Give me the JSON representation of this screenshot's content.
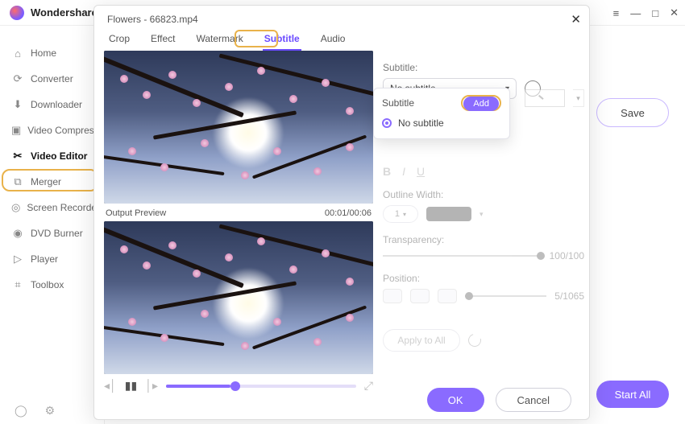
{
  "app": {
    "brand": "Wondershare"
  },
  "window_controls": {
    "hamburger": "≡",
    "min": "—",
    "max": "□",
    "close": "✕"
  },
  "sidebar": {
    "items": [
      {
        "label": "Home",
        "icon": "⌂"
      },
      {
        "label": "Converter",
        "icon": "⟳"
      },
      {
        "label": "Downloader",
        "icon": "⬇"
      },
      {
        "label": "Video Compressor",
        "icon": "▣"
      },
      {
        "label": "Video Editor",
        "icon": "✂"
      },
      {
        "label": "Merger",
        "icon": "⧉"
      },
      {
        "label": "Screen Recorder",
        "icon": "◎"
      },
      {
        "label": "DVD Burner",
        "icon": "◉"
      },
      {
        "label": "Player",
        "icon": "▷"
      },
      {
        "label": "Toolbox",
        "icon": "⌗"
      }
    ],
    "active_index": 4,
    "bottom": {
      "user": "◯",
      "settings": "⚙"
    }
  },
  "background_panel": {
    "save_label": "Save",
    "start_all_label": "Start All"
  },
  "modal": {
    "title": "Flowers - 66823.mp4",
    "tabs": [
      "Crop",
      "Effect",
      "Watermark",
      "Subtitle",
      "Audio"
    ],
    "active_tab_index": 3,
    "preview": {
      "output_label": "Output Preview",
      "timecode": "00:01/00:06"
    },
    "settings": {
      "subtitle_label": "Subtitle:",
      "subtitle_value": "No subtitle",
      "popover": {
        "heading": "Subtitle",
        "add_label": "Add",
        "option": "No subtitle"
      },
      "outline_label": "Outline Width:",
      "outline_value": "1",
      "transparency_label": "Transparency:",
      "transparency_value": "100/100",
      "position_label": "Position:",
      "position_value": "5/1065",
      "apply_label": "Apply to All"
    },
    "footer": {
      "ok": "OK",
      "cancel": "Cancel"
    }
  }
}
